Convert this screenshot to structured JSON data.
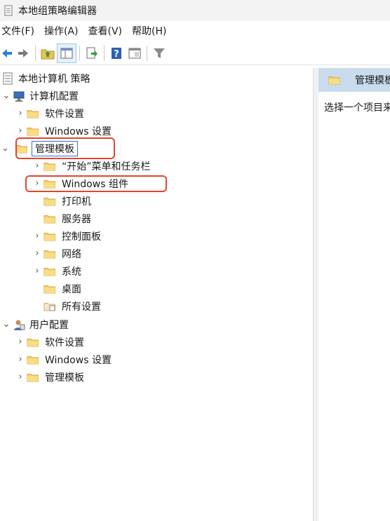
{
  "window": {
    "title": "本地组策略编辑器"
  },
  "menu": [
    {
      "label": "文件(F)"
    },
    {
      "label": "操作(A)"
    },
    {
      "label": "查看(V)"
    },
    {
      "label": "帮助(H)"
    }
  ],
  "tree": {
    "root": "本地计算机 策略",
    "computer_config": {
      "label": "计算机配置",
      "software": "软件设置",
      "windows": "Windows 设置",
      "admin_templates": {
        "label": "管理模板",
        "start_menu": "“开始”菜单和任务栏",
        "windows_components": "Windows 组件",
        "printers": "打印机",
        "server": "服务器",
        "control_panel": "控制面板",
        "network": "网络",
        "system": "系统",
        "desktop": "桌面",
        "all_settings": "所有设置"
      }
    },
    "user_config": {
      "label": "用户配置",
      "software": "软件设置",
      "windows": "Windows 设置",
      "admin_templates": "管理模板"
    }
  },
  "right_pane": {
    "header": "管理模板",
    "description": "选择一个项目来"
  },
  "colors": {
    "highlight": "#e2452c",
    "selection_border": "#2a6fd6",
    "right_header_bg": "#c9dcee",
    "folder": "#f5cf6b"
  }
}
